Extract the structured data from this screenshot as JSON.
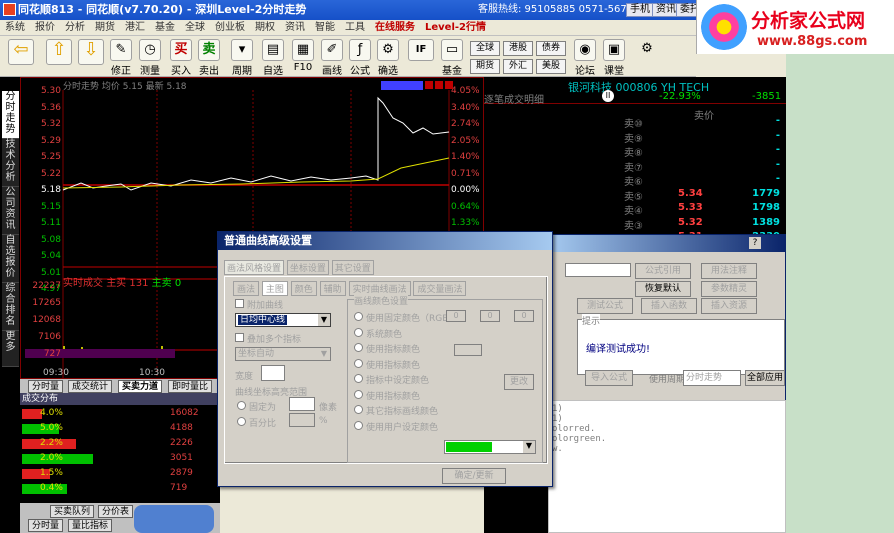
{
  "window": {
    "title": "同花顺813 - 同花顺(v7.70.20) - 深圳Level-2分时走势",
    "hotline": "客服热线: 95105885 0571-56768888",
    "buttons": [
      "手机",
      "资讯",
      "委托"
    ]
  },
  "logo": {
    "title": "分析家公式网",
    "url": "www.88gs.com"
  },
  "menu": [
    "系统",
    "报价",
    "分析",
    "期货",
    "港汇",
    "基金",
    "全球",
    "创业板",
    "期权",
    "资讯",
    "智能",
    "工具",
    "在线服务",
    "Level-2行情"
  ],
  "toolbar": {
    "nav": [
      "修正",
      "测量"
    ],
    "items": [
      "买入",
      "卖出",
      "周期",
      "自选",
      "F10",
      "画线",
      "公式",
      "确选",
      "基金"
    ],
    "markets": [
      "全球",
      "港股",
      "债券",
      "期货",
      "外汇",
      "美股"
    ],
    "right": [
      "论坛",
      "课堂"
    ]
  },
  "left_tabs": [
    "分时走势",
    "技术分析",
    "公司资讯",
    "自选报价",
    "综合排名",
    "更多"
  ],
  "chart": {
    "header": "分时走势 均价 5.15 最新 5.18",
    "y_left": [
      "5.30",
      "5.36",
      "5.32",
      "5.29",
      "5.25",
      "5.22",
      "5.18",
      "5.15",
      "5.11",
      "5.08",
      "5.04",
      "5.01",
      "4.97"
    ],
    "y_right": [
      "4.05%",
      "3.40%",
      "2.74%",
      "2.05%",
      "1.40%",
      "0.71%",
      "0.00%",
      "0.64%",
      "1.33%",
      "1.98%"
    ],
    "vol_header": {
      "label": "实时成交",
      "buy_label": "主买",
      "buy": "131",
      "sell_label": "主卖",
      "sell": "0"
    },
    "vol_y": [
      "22227",
      "17265",
      "12068",
      "7106",
      "727"
    ],
    "x_labels": [
      "09:30",
      "10:30"
    ]
  },
  "bottom_tabs": [
    "分时量",
    "成交统计",
    "买卖力道",
    "即时量比"
  ],
  "bottom_tabs2": [
    "买卖队列",
    "分价表"
  ],
  "bottom_tabs3": [
    "分时量",
    "量比指标"
  ],
  "dist": {
    "title": "成交分布",
    "rows": [
      {
        "pct": "4.0%",
        "val": "16082"
      },
      {
        "pct": "5.0%",
        "val": "4188"
      },
      {
        "pct": "2.2%",
        "val": "2226"
      },
      {
        "pct": "2.0%",
        "val": "3051"
      },
      {
        "pct": "1.5%",
        "val": "2879"
      },
      {
        "pct": "0.4%",
        "val": "719"
      }
    ],
    "extra": [
      "29",
      "24.0"
    ]
  },
  "quote": {
    "name": "银河科技 000806 YH TECH",
    "change_pct": "-22.93%",
    "change": "-3851",
    "title": "逐笔成交明细",
    "levels": [
      {
        "label": "卖⑩",
        "price": "",
        "vol": "-"
      },
      {
        "label": "卖⑨",
        "price": "",
        "vol": "-"
      },
      {
        "label": "卖⑧",
        "price": "",
        "vol": "-"
      },
      {
        "label": "卖⑦",
        "price": "",
        "vol": "-"
      },
      {
        "label": "卖⑥",
        "price": "",
        "vol": "-"
      },
      {
        "label": "卖⑤",
        "price": "5.34",
        "vol": "1779"
      },
      {
        "label": "卖④",
        "price": "5.33",
        "vol": "1798"
      },
      {
        "label": "卖③",
        "price": "5.32",
        "vol": "1389"
      },
      {
        "label": "卖②",
        "price": "5.31",
        "vol": "2330"
      }
    ],
    "sell_label": "卖价"
  },
  "dialog": {
    "title": "普通曲线高级设置",
    "tabs": [
      "画法风格设置",
      "坐标设置",
      "其它设置"
    ],
    "subtabs": [
      "画法",
      "主图",
      "颜色",
      "辅助",
      "实时曲线画法",
      "成交量画法"
    ],
    "chk1": "附加曲线",
    "select1": "日均中心线",
    "chk2": "叠加多个指标",
    "select2": "坐标自动",
    "width_label": "宽度",
    "radio1": "固定为",
    "unit1": "像素",
    "radio2": "百分比",
    "unit2": "%",
    "group_title": "画线颜色设置",
    "color_opts": [
      "使用固定颜色（RGB）",
      "系统颜色",
      "使用指标颜色",
      "使用指标颜色",
      "指标中设定颜色",
      "使用指标颜色",
      "其它指标画线颜色",
      "使用用户设定颜色"
    ],
    "rgb": [
      "0",
      "0",
      "0"
    ],
    "change_btn": "更改",
    "ok_btn": "确定/更新",
    "section_left": "曲线坐标高亮范围"
  },
  "dialog2": {
    "buttons": [
      "公式引用",
      "用法注释",
      "恢复默认",
      "参数精灵",
      "测试公式",
      "插入函数",
      "插入资源",
      "导入公式",
      "全部应用"
    ],
    "message_label": "提示",
    "message": "编译测试成功!",
    "period_label": "使用周期",
    "period_value": "分时走势"
  },
  "code": {
    "lines": [
      "1)",
      "1)",
      "olorred.",
      "olorgreen.",
      "w."
    ]
  }
}
